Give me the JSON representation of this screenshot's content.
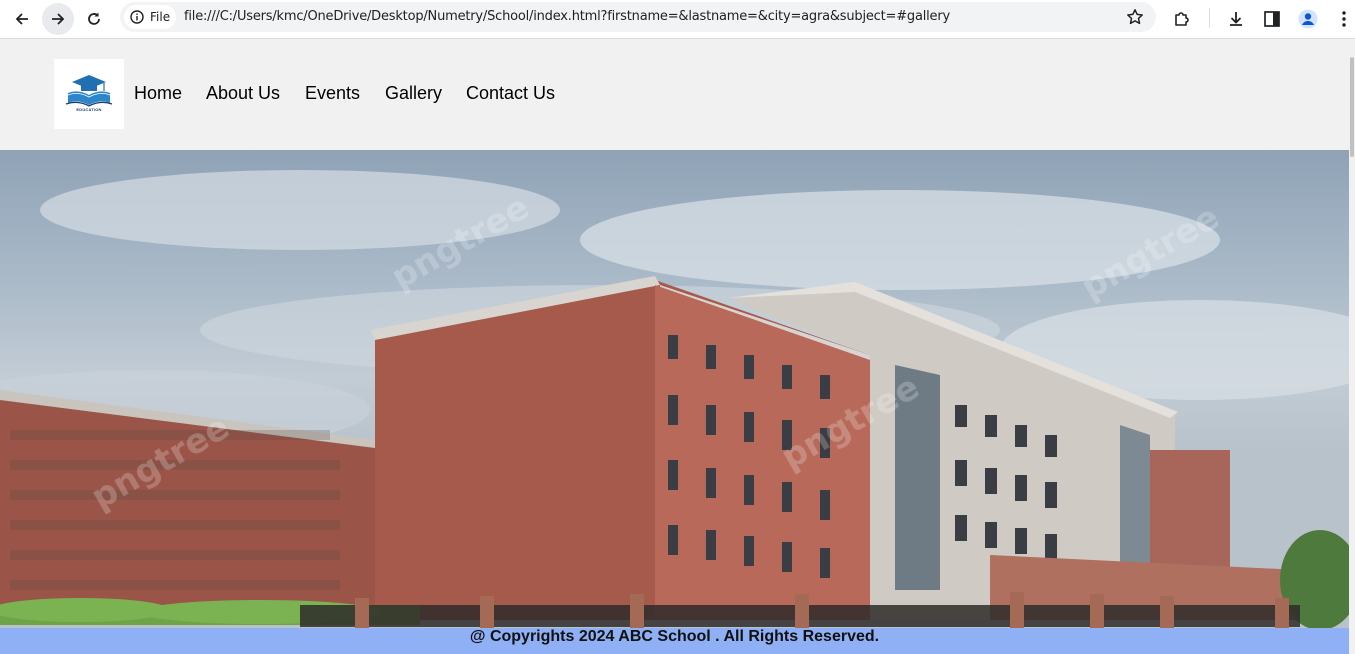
{
  "browser": {
    "file_chip_label": "File",
    "url": "file:///C:/Users/kmc/OneDrive/Desktop/Numetry/School/index.html?firstname=&lastname=&city=agra&subject=#gallery"
  },
  "header": {
    "logo_caption": "EDUCATION",
    "nav": [
      {
        "label": "Home"
      },
      {
        "label": "About Us"
      },
      {
        "label": "Events"
      },
      {
        "label": "Gallery"
      },
      {
        "label": "Contact Us"
      }
    ]
  },
  "hero": {
    "watermark": "pngtree"
  },
  "footer": {
    "text": "@ Copyrights 2024 ABC School . All Rights Reserved."
  },
  "colors": {
    "header_bg": "#f1f1f1",
    "footer_bg": "#8fb0f5",
    "logo_blue": "#1f6fb2"
  }
}
